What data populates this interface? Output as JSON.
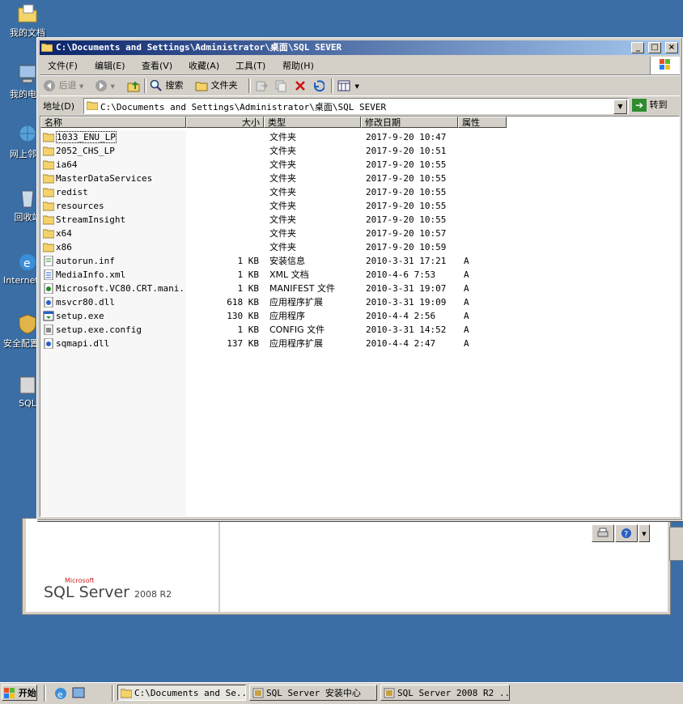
{
  "desktop": {
    "icons": [
      {
        "label": "我的文档",
        "icon": "my-documents-icon"
      },
      {
        "label": "我的电脑",
        "icon": "my-computer-icon"
      },
      {
        "label": "网上邻居",
        "icon": "network-icon"
      },
      {
        "label": "回收站",
        "icon": "recycle-bin-icon"
      },
      {
        "label": "Internet Explorer",
        "icon": "ie-icon"
      },
      {
        "label": "安全配置向导",
        "icon": "security-icon"
      },
      {
        "label": "SQL",
        "icon": "sql-icon"
      }
    ]
  },
  "background_window": {
    "logo_brand": "Microsoft",
    "logo_product": "SQL Server",
    "logo_version": "2008 R2"
  },
  "window": {
    "title": "C:\\Documents and Settings\\Administrator\\桌面\\SQL SEVER",
    "controls": {
      "minimize": "_",
      "maximize": "□",
      "close": "×"
    }
  },
  "menubar": {
    "file": "文件(F)",
    "edit": "编辑(E)",
    "view": "查看(V)",
    "favorites": "收藏(A)",
    "tools": "工具(T)",
    "help": "帮助(H)"
  },
  "toolbar": {
    "back": "后退",
    "search": "搜索",
    "folders": "文件夹"
  },
  "addressbar": {
    "label": "地址(D)",
    "path": "C:\\Documents and Settings\\Administrator\\桌面\\SQL SEVER",
    "go": "转到"
  },
  "columns": {
    "name": "名称",
    "size": "大小",
    "type": "类型",
    "modified": "修改日期",
    "attributes": "属性"
  },
  "files": [
    {
      "name": "1033_ENU_LP",
      "size": "",
      "type": "文件夹",
      "modified": "2017-9-20 10:47",
      "attr": "",
      "icon": "folder-icon"
    },
    {
      "name": "2052_CHS_LP",
      "size": "",
      "type": "文件夹",
      "modified": "2017-9-20 10:51",
      "attr": "",
      "icon": "folder-icon"
    },
    {
      "name": "ia64",
      "size": "",
      "type": "文件夹",
      "modified": "2017-9-20 10:55",
      "attr": "",
      "icon": "folder-icon"
    },
    {
      "name": "MasterDataServices",
      "size": "",
      "type": "文件夹",
      "modified": "2017-9-20 10:55",
      "attr": "",
      "icon": "folder-icon"
    },
    {
      "name": "redist",
      "size": "",
      "type": "文件夹",
      "modified": "2017-9-20 10:55",
      "attr": "",
      "icon": "folder-icon"
    },
    {
      "name": "resources",
      "size": "",
      "type": "文件夹",
      "modified": "2017-9-20 10:55",
      "attr": "",
      "icon": "folder-icon"
    },
    {
      "name": "StreamInsight",
      "size": "",
      "type": "文件夹",
      "modified": "2017-9-20 10:55",
      "attr": "",
      "icon": "folder-icon"
    },
    {
      "name": "x64",
      "size": "",
      "type": "文件夹",
      "modified": "2017-9-20 10:57",
      "attr": "",
      "icon": "folder-icon"
    },
    {
      "name": "x86",
      "size": "",
      "type": "文件夹",
      "modified": "2017-9-20 10:59",
      "attr": "",
      "icon": "folder-icon"
    },
    {
      "name": "autorun.inf",
      "size": "1 KB",
      "type": "安装信息",
      "modified": "2010-3-31 17:21",
      "attr": "A",
      "icon": "inf-file-icon"
    },
    {
      "name": "MediaInfo.xml",
      "size": "1 KB",
      "type": "XML 文档",
      "modified": "2010-4-6 7:53",
      "attr": "A",
      "icon": "xml-file-icon"
    },
    {
      "name": "Microsoft.VC80.CRT.mani...",
      "size": "1 KB",
      "type": "MANIFEST 文件",
      "modified": "2010-3-31 19:07",
      "attr": "A",
      "icon": "manifest-file-icon"
    },
    {
      "name": "msvcr80.dll",
      "size": "618 KB",
      "type": "应用程序扩展",
      "modified": "2010-3-31 19:09",
      "attr": "A",
      "icon": "dll-file-icon"
    },
    {
      "name": "setup.exe",
      "size": "130 KB",
      "type": "应用程序",
      "modified": "2010-4-4 2:56",
      "attr": "A",
      "icon": "exe-file-icon"
    },
    {
      "name": "setup.exe.config",
      "size": "1 KB",
      "type": "CONFIG 文件",
      "modified": "2010-3-31 14:52",
      "attr": "A",
      "icon": "config-file-icon"
    },
    {
      "name": "sqmapi.dll",
      "size": "137 KB",
      "type": "应用程序扩展",
      "modified": "2010-4-4 2:47",
      "attr": "A",
      "icon": "dll-file-icon"
    }
  ],
  "taskbar": {
    "start": "开始",
    "tasks": [
      {
        "label": "C:\\Documents and Se...",
        "active": true
      },
      {
        "label": "SQL Server 安装中心",
        "active": false
      },
      {
        "label": "SQL Server 2008 R2 ...",
        "active": false
      }
    ]
  },
  "colors": {
    "desktop": "#3a6ea5",
    "titlebar_start": "#0a246a",
    "titlebar_end": "#a6caf0",
    "chrome": "#d4d0c8"
  }
}
